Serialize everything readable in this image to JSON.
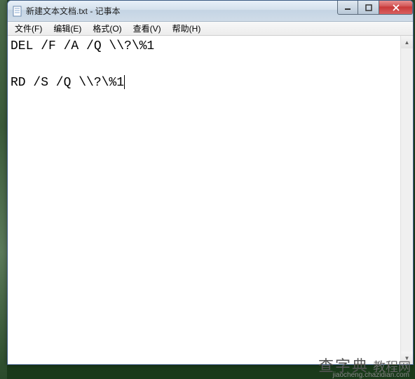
{
  "window": {
    "title": "新建文本文档.txt - 记事本",
    "controls": {
      "min": "minimize",
      "max": "maximize",
      "close": "close"
    }
  },
  "menu": {
    "file": "文件(F)",
    "edit": "编辑(E)",
    "format": "格式(O)",
    "view": "查看(V)",
    "help": "帮助(H)"
  },
  "editor": {
    "line1": "DEL /F /A /Q \\\\?\\%1",
    "line2": "",
    "line3": "RD /S /Q \\\\?\\%1"
  },
  "watermark": {
    "main": "查字典",
    "sub": "教程网",
    "url": "jiaocheng.chazidian.com"
  }
}
